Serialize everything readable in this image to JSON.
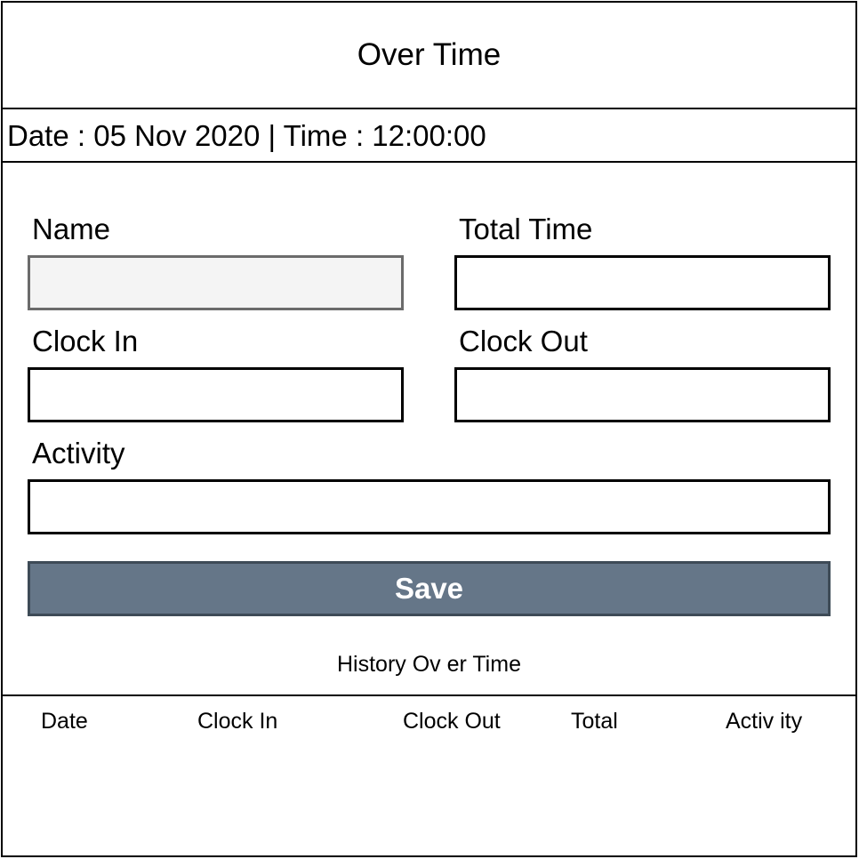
{
  "header": {
    "title": "Over Time",
    "datetime": "Date : 05 Nov 2020 | Time : 12:00:00"
  },
  "form": {
    "name_label": "Name",
    "name_value": "",
    "total_time_label": "Total Time",
    "total_time_value": "",
    "clock_in_label": "Clock In",
    "clock_in_value": "",
    "clock_out_label": "Clock Out",
    "clock_out_value": "",
    "activity_label": "Activity",
    "activity_value": "",
    "save_label": "Save"
  },
  "history": {
    "title": "History  Ov er Time",
    "columns": [
      "Date",
      "Clock  In",
      "Clock  Out",
      "Total",
      "Activ ity"
    ],
    "rows": []
  },
  "colors": {
    "save_button_bg": "#657688",
    "save_button_border": "#3e4b57",
    "readonly_field_bg": "#f4f4f4"
  }
}
